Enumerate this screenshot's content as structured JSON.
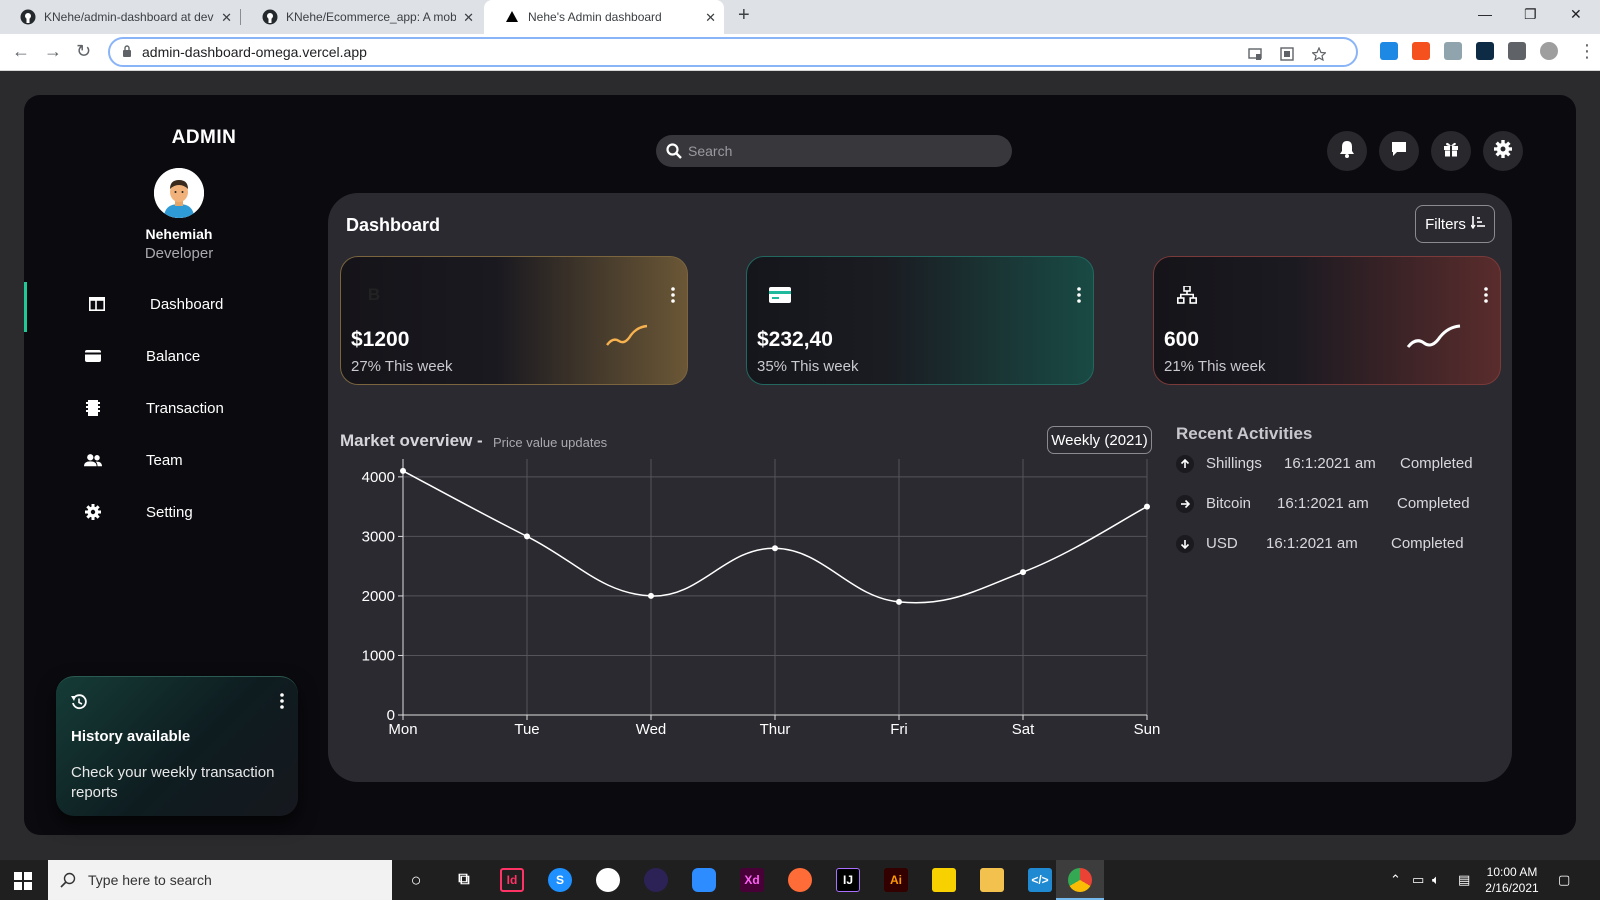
{
  "browser": {
    "tabs": [
      {
        "title": "KNehe/admin-dashboard at deve"
      },
      {
        "title": "KNehe/Ecommerce_app: A mobil"
      },
      {
        "title": "Nehe's Admin dashboard"
      }
    ],
    "url": "admin-dashboard-omega.vercel.app"
  },
  "sidebar": {
    "brand": "ADMIN",
    "user_name": "Nehemiah",
    "user_role": "Developer",
    "items": [
      {
        "label": "Dashboard",
        "icon": "dashboard-icon"
      },
      {
        "label": "Balance",
        "icon": "wallet-icon"
      },
      {
        "label": "Transaction",
        "icon": "receipt-icon"
      },
      {
        "label": "Team",
        "icon": "team-icon"
      },
      {
        "label": "Setting",
        "icon": "gear-icon"
      }
    ],
    "history": {
      "title": "History available",
      "desc": "Check your weekly transaction reports"
    }
  },
  "search": {
    "placeholder": "Search"
  },
  "header_icons": [
    "bell-icon",
    "chat-icon",
    "gift-icon",
    "settings-icon"
  ],
  "main": {
    "title": "Dashboard",
    "filters_label": "Filters",
    "cards": [
      {
        "icon_text": "B",
        "value": "$1200",
        "sub": "27% This week",
        "accent": "#f7b24f"
      },
      {
        "icon_text": "",
        "value": "$232,40",
        "sub": "35% This week",
        "accent": "#1fb99e"
      },
      {
        "icon_text": "",
        "value": "600",
        "sub": "21% This week",
        "accent": "#e9776a"
      }
    ],
    "market": {
      "title": "Market overview",
      "dash": "-",
      "subtitle": "Price value updates",
      "period": "Weekly (2021)"
    },
    "recent": {
      "title": "Recent Activities",
      "rows": [
        {
          "name": "Shillings",
          "time": "16:1:2021 am",
          "status": "Completed",
          "dir": "up"
        },
        {
          "name": "Bitcoin",
          "time": "16:1:2021 am",
          "status": "Completed",
          "dir": "right"
        },
        {
          "name": "USD",
          "time": "16:1:2021 am",
          "status": "Completed",
          "dir": "down"
        }
      ]
    }
  },
  "chart_data": {
    "type": "line",
    "categories": [
      "Mon",
      "Tue",
      "Wed",
      "Thur",
      "Fri",
      "Sat",
      "Sun"
    ],
    "series": [
      {
        "values": [
          4100,
          3000,
          2000,
          2800,
          1900,
          2400,
          3500
        ]
      }
    ],
    "ylim": [
      0,
      4300
    ],
    "yticks": [
      0,
      1000,
      2000,
      3000,
      4000
    ],
    "grid": true,
    "line_color": "#ffffff"
  },
  "taskbar": {
    "search_placeholder": "Type here to search",
    "time": "10:00 AM",
    "date": "2/16/2021"
  }
}
